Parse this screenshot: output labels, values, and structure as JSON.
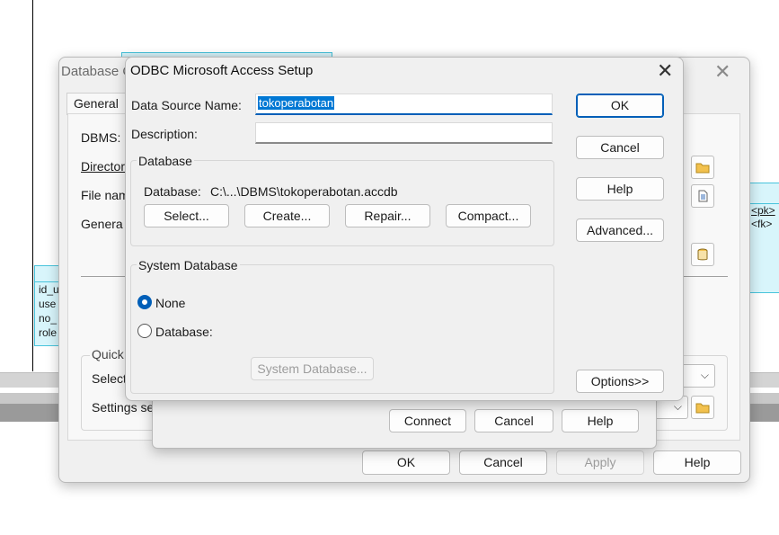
{
  "background": {
    "entity_left_rows": [
      "id_u",
      "use",
      "no_",
      "role"
    ],
    "entity_right_rows": [
      "<pk>",
      "<fk>"
    ]
  },
  "db_connection": {
    "title": "Database C",
    "tab": "General",
    "labels": {
      "dbms": "DBMS:",
      "directory": "Directory",
      "file_name": "File nam",
      "generation": "Genera",
      "quick": "Quick",
      "select": "Select",
      "settings": "Settings set"
    },
    "buttons": {
      "connect": "Connect",
      "cancel_inner": "Cancel",
      "help_inner": "Help",
      "ok": "OK",
      "cancel": "Cancel",
      "apply": "Apply",
      "help": "Help"
    }
  },
  "odbc": {
    "title": "ODBC Microsoft Access Setup",
    "data_source_name_label": "Data Source Name:",
    "data_source_name_value": "tokoperabotan",
    "description_label": "Description:",
    "description_value": "",
    "database_group": "Database",
    "database_label": "Database:",
    "database_path": "C:\\...\\DBMS\\tokoperabotan.accdb",
    "buttons": {
      "select": "Select...",
      "create": "Create...",
      "repair": "Repair...",
      "compact": "Compact...",
      "ok": "OK",
      "cancel": "Cancel",
      "help": "Help",
      "advanced": "Advanced...",
      "options": "Options>>",
      "system_database": "System Database..."
    },
    "system_database_group": "System Database",
    "radio_none": "None",
    "radio_database": "Database:",
    "selected_radio": "None"
  },
  "colors": {
    "accent": "#005fb8",
    "selection": "#0078d4",
    "entity_fill": "#d8f5fb",
    "entity_border": "#49c4dc"
  }
}
